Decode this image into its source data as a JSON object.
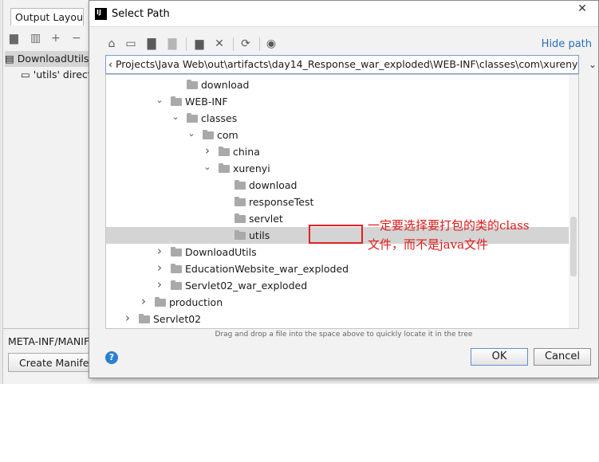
{
  "background": {
    "output_layout_tab": "Output Layout",
    "list_items": [
      {
        "label": "DownloadUtils.",
        "selected": true
      },
      {
        "label": "'utils' direct",
        "selected": false
      }
    ],
    "manifest_label": "META-INF/MANIF",
    "create_manifest_button": "Create Manifes"
  },
  "dialog": {
    "title": "Select Path",
    "hide_path_link": "Hide path",
    "path_value": "‹ Projects\\Java Web\\out\\artifacts\\day14_Response_war_exploded\\WEB-INF\\classes\\com\\xurenyi\\utils",
    "tree_rows": [
      {
        "label": "download",
        "expander": "none",
        "selected": false
      },
      {
        "label": "WEB-INF",
        "expander": "expanded",
        "selected": false
      },
      {
        "label": "classes",
        "expander": "expanded",
        "selected": false
      },
      {
        "label": "com",
        "expander": "expanded",
        "selected": false
      },
      {
        "label": "china",
        "expander": "collapsed",
        "selected": false
      },
      {
        "label": "xurenyi",
        "expander": "expanded",
        "selected": false
      },
      {
        "label": "download",
        "expander": "none",
        "selected": false
      },
      {
        "label": "responseTest",
        "expander": "none",
        "selected": false
      },
      {
        "label": "servlet",
        "expander": "none",
        "selected": false
      },
      {
        "label": "utils",
        "expander": "none",
        "selected": true
      },
      {
        "label": "DownloadUtils",
        "expander": "collapsed",
        "selected": false
      },
      {
        "label": "EducationWebsite_war_exploded",
        "expander": "collapsed",
        "selected": false
      },
      {
        "label": "Servlet02_war_exploded",
        "expander": "collapsed",
        "selected": false
      },
      {
        "label": "production",
        "expander": "collapsed",
        "selected": false
      },
      {
        "label": "Servlet02",
        "expander": "collapsed",
        "selected": false
      }
    ],
    "status_hint": "Drag and drop a file into the space above to quickly locate it in the tree",
    "ok_button": "OK",
    "cancel_button": "Cancel"
  },
  "annotation": {
    "line1": "一定要选择要打包的类的class",
    "line2": "文件，而不是java文件",
    "color": "#e01b1b"
  }
}
